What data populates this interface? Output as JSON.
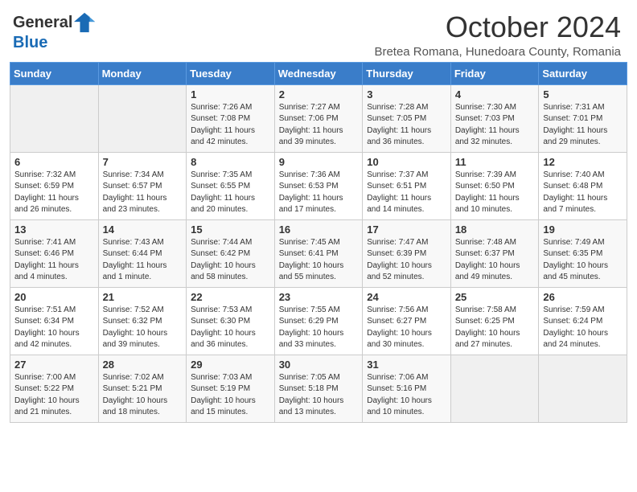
{
  "header": {
    "logo_general": "General",
    "logo_blue": "Blue",
    "month_title": "October 2024",
    "subtitle": "Bretea Romana, Hunedoara County, Romania"
  },
  "days_of_week": [
    "Sunday",
    "Monday",
    "Tuesday",
    "Wednesday",
    "Thursday",
    "Friday",
    "Saturday"
  ],
  "weeks": [
    [
      {
        "day": "",
        "info": ""
      },
      {
        "day": "",
        "info": ""
      },
      {
        "day": "1",
        "info": "Sunrise: 7:26 AM\nSunset: 7:08 PM\nDaylight: 11 hours and 42 minutes."
      },
      {
        "day": "2",
        "info": "Sunrise: 7:27 AM\nSunset: 7:06 PM\nDaylight: 11 hours and 39 minutes."
      },
      {
        "day": "3",
        "info": "Sunrise: 7:28 AM\nSunset: 7:05 PM\nDaylight: 11 hours and 36 minutes."
      },
      {
        "day": "4",
        "info": "Sunrise: 7:30 AM\nSunset: 7:03 PM\nDaylight: 11 hours and 32 minutes."
      },
      {
        "day": "5",
        "info": "Sunrise: 7:31 AM\nSunset: 7:01 PM\nDaylight: 11 hours and 29 minutes."
      }
    ],
    [
      {
        "day": "6",
        "info": "Sunrise: 7:32 AM\nSunset: 6:59 PM\nDaylight: 11 hours and 26 minutes."
      },
      {
        "day": "7",
        "info": "Sunrise: 7:34 AM\nSunset: 6:57 PM\nDaylight: 11 hours and 23 minutes."
      },
      {
        "day": "8",
        "info": "Sunrise: 7:35 AM\nSunset: 6:55 PM\nDaylight: 11 hours and 20 minutes."
      },
      {
        "day": "9",
        "info": "Sunrise: 7:36 AM\nSunset: 6:53 PM\nDaylight: 11 hours and 17 minutes."
      },
      {
        "day": "10",
        "info": "Sunrise: 7:37 AM\nSunset: 6:51 PM\nDaylight: 11 hours and 14 minutes."
      },
      {
        "day": "11",
        "info": "Sunrise: 7:39 AM\nSunset: 6:50 PM\nDaylight: 11 hours and 10 minutes."
      },
      {
        "day": "12",
        "info": "Sunrise: 7:40 AM\nSunset: 6:48 PM\nDaylight: 11 hours and 7 minutes."
      }
    ],
    [
      {
        "day": "13",
        "info": "Sunrise: 7:41 AM\nSunset: 6:46 PM\nDaylight: 11 hours and 4 minutes."
      },
      {
        "day": "14",
        "info": "Sunrise: 7:43 AM\nSunset: 6:44 PM\nDaylight: 11 hours and 1 minute."
      },
      {
        "day": "15",
        "info": "Sunrise: 7:44 AM\nSunset: 6:42 PM\nDaylight: 10 hours and 58 minutes."
      },
      {
        "day": "16",
        "info": "Sunrise: 7:45 AM\nSunset: 6:41 PM\nDaylight: 10 hours and 55 minutes."
      },
      {
        "day": "17",
        "info": "Sunrise: 7:47 AM\nSunset: 6:39 PM\nDaylight: 10 hours and 52 minutes."
      },
      {
        "day": "18",
        "info": "Sunrise: 7:48 AM\nSunset: 6:37 PM\nDaylight: 10 hours and 49 minutes."
      },
      {
        "day": "19",
        "info": "Sunrise: 7:49 AM\nSunset: 6:35 PM\nDaylight: 10 hours and 45 minutes."
      }
    ],
    [
      {
        "day": "20",
        "info": "Sunrise: 7:51 AM\nSunset: 6:34 PM\nDaylight: 10 hours and 42 minutes."
      },
      {
        "day": "21",
        "info": "Sunrise: 7:52 AM\nSunset: 6:32 PM\nDaylight: 10 hours and 39 minutes."
      },
      {
        "day": "22",
        "info": "Sunrise: 7:53 AM\nSunset: 6:30 PM\nDaylight: 10 hours and 36 minutes."
      },
      {
        "day": "23",
        "info": "Sunrise: 7:55 AM\nSunset: 6:29 PM\nDaylight: 10 hours and 33 minutes."
      },
      {
        "day": "24",
        "info": "Sunrise: 7:56 AM\nSunset: 6:27 PM\nDaylight: 10 hours and 30 minutes."
      },
      {
        "day": "25",
        "info": "Sunrise: 7:58 AM\nSunset: 6:25 PM\nDaylight: 10 hours and 27 minutes."
      },
      {
        "day": "26",
        "info": "Sunrise: 7:59 AM\nSunset: 6:24 PM\nDaylight: 10 hours and 24 minutes."
      }
    ],
    [
      {
        "day": "27",
        "info": "Sunrise: 7:00 AM\nSunset: 5:22 PM\nDaylight: 10 hours and 21 minutes."
      },
      {
        "day": "28",
        "info": "Sunrise: 7:02 AM\nSunset: 5:21 PM\nDaylight: 10 hours and 18 minutes."
      },
      {
        "day": "29",
        "info": "Sunrise: 7:03 AM\nSunset: 5:19 PM\nDaylight: 10 hours and 15 minutes."
      },
      {
        "day": "30",
        "info": "Sunrise: 7:05 AM\nSunset: 5:18 PM\nDaylight: 10 hours and 13 minutes."
      },
      {
        "day": "31",
        "info": "Sunrise: 7:06 AM\nSunset: 5:16 PM\nDaylight: 10 hours and 10 minutes."
      },
      {
        "day": "",
        "info": ""
      },
      {
        "day": "",
        "info": ""
      }
    ]
  ]
}
